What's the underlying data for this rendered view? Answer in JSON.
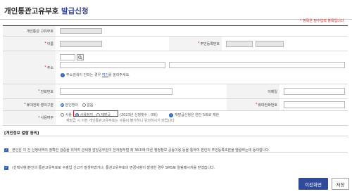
{
  "page": {
    "title_main": "개인통관고유부호",
    "title_accent": "발급신청",
    "required_note": "* 항목은 필수입력 항목입니다."
  },
  "form": {
    "customs_code_label": "개인통관 고유부호",
    "name_label": "이름",
    "rrn_label": "주민등록번호",
    "address_label": "주소",
    "address_help_prefix": "주소검색이 안되는 경우",
    "address_help_link": "여기",
    "address_help_suffix": "를 눌러주세요.",
    "phone_label": "전화번호",
    "email_label": "이메일",
    "auth_label": "휴대전화 영의구분",
    "auth_options": [
      "본인명의",
      "없음"
    ],
    "mobile_label": "휴대전화번호",
    "reason_label": "사용여부",
    "reason_options": [
      "사용",
      "사용정지",
      "재발급"
    ],
    "reason_count_text": "(2023년 신청횟수 : 0회)",
    "reason_limit_text": "재발급신청은 연간 5회로 제한",
    "reason_note": "재발급 시 이전 개인통관고유부호는 사용이 불가하니 유의하시기 바랍니다"
  },
  "consent": {
    "title": "[개인정보 열람 동의]",
    "item1": "본인은 이 건 신청내역의 정확한 검증을 위하여 관세청 암앙공무원이 전자정부법 제 36조에 따른 행정정보 공동이용 등을 통하여 본인의 주민등록초본을 열람하는데 동의합니다.",
    "item2": "(선택사항)본인의 통관고유부호로 수출입 신고가 발생하였거나, 통관고유부호의 변경사항이 발생한 경우 SMS로 알림메시지를 받겠습니다."
  },
  "buttons": {
    "prev": "이전화면",
    "save": "저장"
  },
  "colors": {
    "accent": "#2e4a98",
    "required": "#d02626",
    "highlight": "#d0111b"
  }
}
